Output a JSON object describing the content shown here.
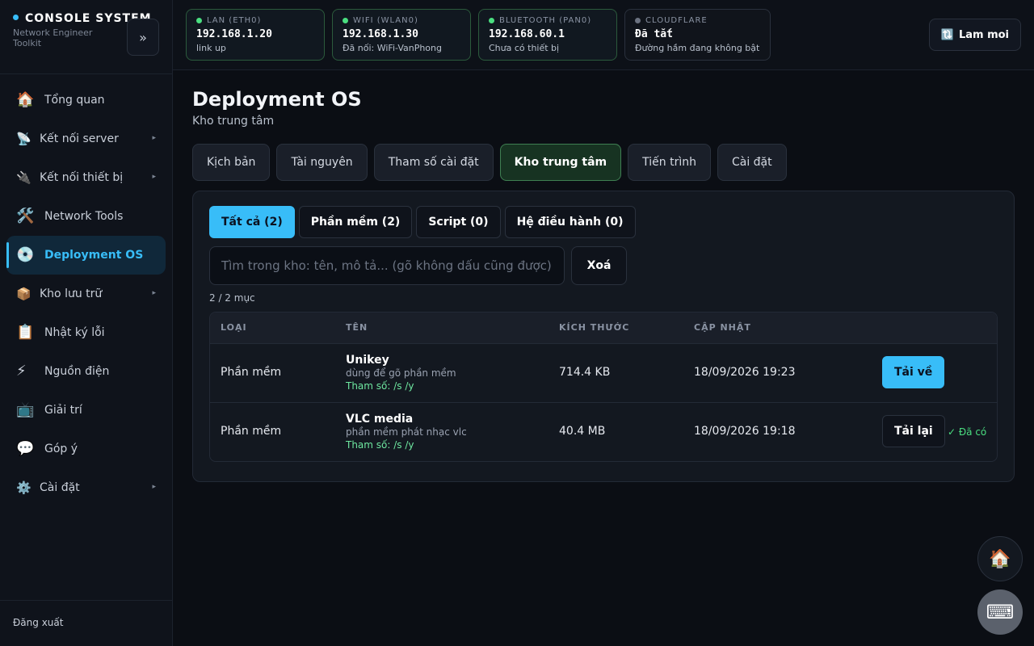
{
  "brand": {
    "title": "CONSOLE SYSTEM",
    "subtitle": "Network Engineer Toolkit",
    "collapse_label": "»"
  },
  "sidebar": {
    "items": [
      {
        "label": "Tổng quan",
        "icon": "🏠"
      },
      {
        "label": "Kết nối server",
        "icon": "📡"
      },
      {
        "label": "Kết nối thiết bị",
        "icon": "🔌"
      },
      {
        "label": "Network Tools",
        "icon": "🛠️"
      },
      {
        "label": "Deployment OS",
        "icon": "💿"
      },
      {
        "label": "Kho lưu trữ",
        "icon": "📦"
      },
      {
        "label": "Nhật ký lỗi",
        "icon": "📋"
      },
      {
        "label": "Nguồn điện",
        "icon": "⚡"
      },
      {
        "label": "Giải trí",
        "icon": "📺"
      },
      {
        "label": "Góp ý",
        "icon": "💬"
      },
      {
        "label": "Cài đặt",
        "icon": "⚙️"
      }
    ],
    "chevron": "▸",
    "logout": "Đăng xuất"
  },
  "network": {
    "lan": {
      "label": "LAN (ETH0)",
      "ip": "192.168.1.20",
      "status": "link up"
    },
    "wifi": {
      "label": "WIFI (WLAN0)",
      "ip": "192.168.1.30",
      "status": "Đã nối: WiFi-VanPhong"
    },
    "bluetooth": {
      "label": "BLUETOOTH (PAN0)",
      "ip": "192.168.60.1",
      "status": "Chưa có thiết bị"
    },
    "cloudflare": {
      "label": "CLOUDFLARE",
      "ip": "Đã tắt",
      "status": "Đường hầm đang không bật"
    },
    "refresh_icon": "🔃",
    "refresh_label": "Lam moi",
    "colors": {
      "online": "#4ade80",
      "offline": "#6b7280"
    }
  },
  "page": {
    "title": "Deployment OS",
    "subtitle": "Kho trung tâm"
  },
  "tabs": [
    "Kịch bản",
    "Tài nguyên",
    "Tham số cài đặt",
    "Kho trung tâm",
    "Tiến trình",
    "Cài đặt"
  ],
  "filters": [
    "Tất cả (2)",
    "Phần mềm (2)",
    "Script (0)",
    "Hệ điều hành (0)"
  ],
  "search": {
    "placeholder": "Tìm trong kho: tên, mô tả... (gõ không dấu cũng được)",
    "value": "",
    "clear_label": "Xoá"
  },
  "count_text": "2 / 2 mục",
  "table": {
    "headers": [
      "LOẠI",
      "TÊN",
      "KÍCH THƯỚC",
      "CẬP NHẬT"
    ],
    "rows": [
      {
        "type": "Phần mềm",
        "name": "Unikey",
        "desc": "dùng để gõ phần mềm",
        "params": "Tham số: /s /y",
        "size": "714.4 KB",
        "updated": "18/09/2026 19:23",
        "action": "Tải về"
      },
      {
        "type": "Phần mềm",
        "name": "VLC media",
        "desc": "phần mềm phát nhạc vlc",
        "params": "Tham số: /s /y",
        "size": "40.4 MB",
        "updated": "18/09/2026 19:18",
        "action": "Tải lại",
        "installed": "✓ Đã có"
      }
    ]
  },
  "fab": {
    "home_icon": "🏠",
    "keyboard_icon": "⌨"
  },
  "colors": {
    "accent": "#38bdf8",
    "active_tab": "#173322",
    "success": "#4ade80",
    "background": "#0b0e14"
  }
}
